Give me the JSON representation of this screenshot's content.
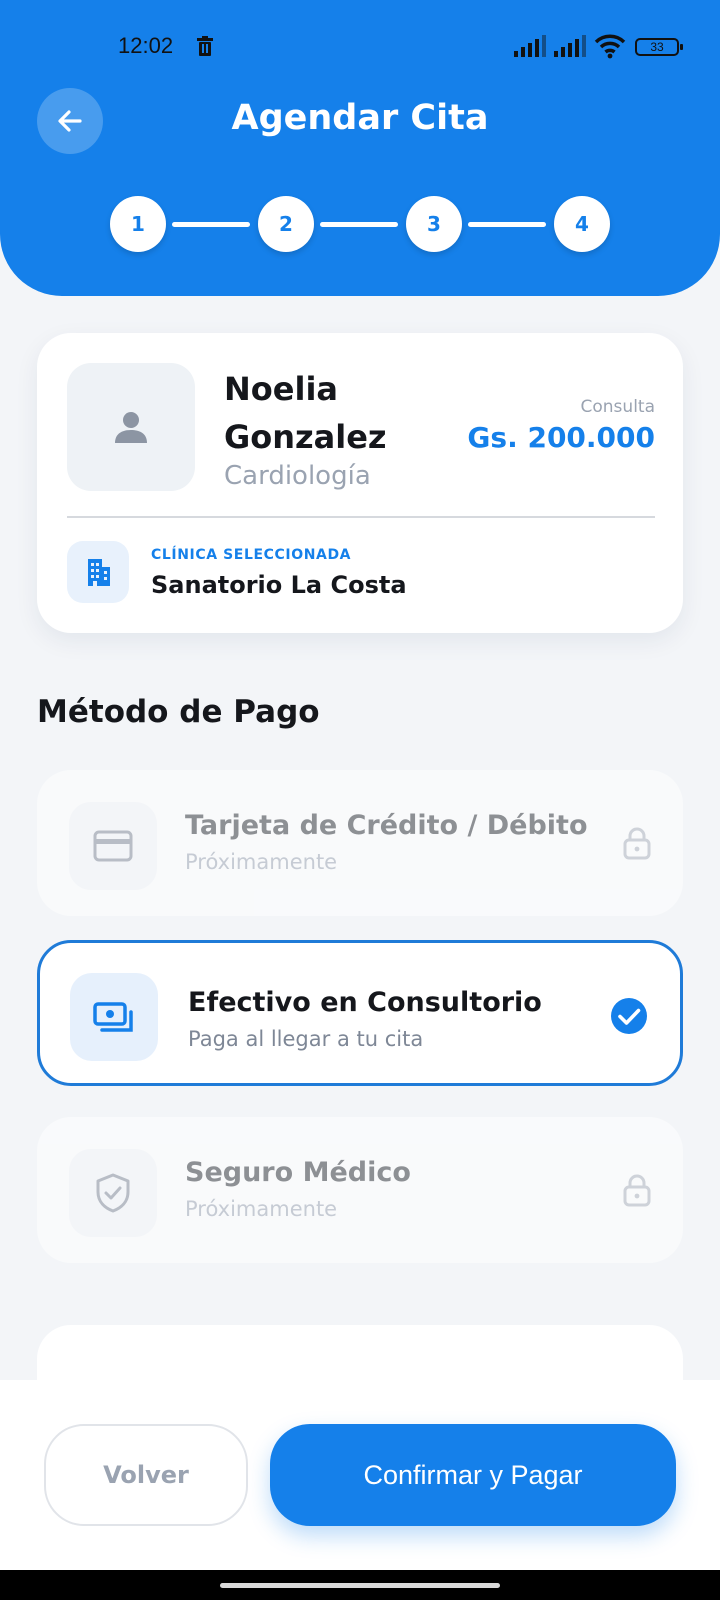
{
  "status_bar": {
    "time": "12:02",
    "battery": "33"
  },
  "header": {
    "title": "Agendar Cita",
    "back_icon": "arrow-left-icon",
    "steps": [
      "1",
      "2",
      "3",
      "4"
    ],
    "colors": {
      "primary": "#1580ea"
    }
  },
  "doctor": {
    "name": "Noelia Gonzalez",
    "specialty": "Cardiología",
    "price_label": "Consulta",
    "price": "Gs. 200.000",
    "avatar_icon": "person-icon"
  },
  "clinic": {
    "label": "CLÍNICA SELECCIONADA",
    "name": "Sanatorio La Costa",
    "icon": "building-icon"
  },
  "payment": {
    "section_title": "Método de Pago",
    "options": [
      {
        "title": "Tarjeta de Crédito / Débito",
        "subtitle": "Próximamente",
        "icon": "credit-card-icon",
        "state": "disabled",
        "trailing_icon": "lock-icon"
      },
      {
        "title": "Efectivo en Consultorio",
        "subtitle": "Paga al llegar a tu cita",
        "icon": "cash-icon",
        "state": "selected",
        "trailing_icon": "check-circle-icon"
      },
      {
        "title": "Seguro Médico",
        "subtitle": "Próximamente",
        "icon": "shield-check-icon",
        "state": "disabled",
        "trailing_icon": "lock-icon"
      }
    ]
  },
  "footer": {
    "back_label": "Volver",
    "confirm_label": "Confirmar y Pagar"
  }
}
